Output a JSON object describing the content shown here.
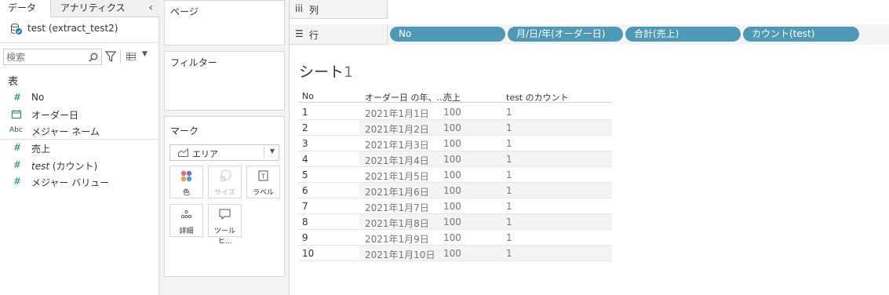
{
  "tabs": {
    "data": "データ",
    "analytics": "アナリティクス"
  },
  "datasource": {
    "name": "test (extract_test2)"
  },
  "search": {
    "placeholder": "検索"
  },
  "table_header": "表",
  "fields": [
    {
      "icon": "#",
      "label": "No"
    },
    {
      "icon": "calendar",
      "label": "オーダー日"
    },
    {
      "icon": "Abc",
      "label": "メジャー ネーム"
    },
    {
      "icon": "#",
      "label": "売上"
    },
    {
      "icon": "#",
      "label_italic": "test",
      "label_rest": " (カウント)"
    },
    {
      "icon": "#",
      "label": "メジャー バリュー"
    }
  ],
  "cards": {
    "pages": "ページ",
    "filters": "フィルター",
    "marks": "マーク",
    "mark_type": "エリア",
    "mark_buttons": {
      "color": "色",
      "size": "サイズ",
      "label": "ラベル",
      "detail": "詳細",
      "tooltip": "ツールヒ..."
    }
  },
  "shelves": {
    "columns_label": "列",
    "rows_label": "行",
    "rows_pills": [
      "No",
      "月/日/年(オーダー日)",
      "合計(売上)",
      "カウント(test)"
    ]
  },
  "sheet": {
    "title": "シート",
    "number": "1"
  },
  "table": {
    "headers": [
      "No",
      "オーダー日 の年、...",
      "売上",
      "test のカウント"
    ],
    "rows": [
      [
        "1",
        "2021年1月1日",
        "100",
        "1"
      ],
      [
        "2",
        "2021年1月2日",
        "100",
        "1"
      ],
      [
        "3",
        "2021年1月3日",
        "100",
        "1"
      ],
      [
        "4",
        "2021年1月4日",
        "100",
        "1"
      ],
      [
        "5",
        "2021年1月5日",
        "100",
        "1"
      ],
      [
        "6",
        "2021年1月6日",
        "100",
        "1"
      ],
      [
        "7",
        "2021年1月7日",
        "100",
        "1"
      ],
      [
        "8",
        "2021年1月8日",
        "100",
        "1"
      ],
      [
        "9",
        "2021年1月9日",
        "100",
        "1"
      ],
      [
        "10",
        "2021年1月10日",
        "100",
        "1"
      ]
    ]
  }
}
